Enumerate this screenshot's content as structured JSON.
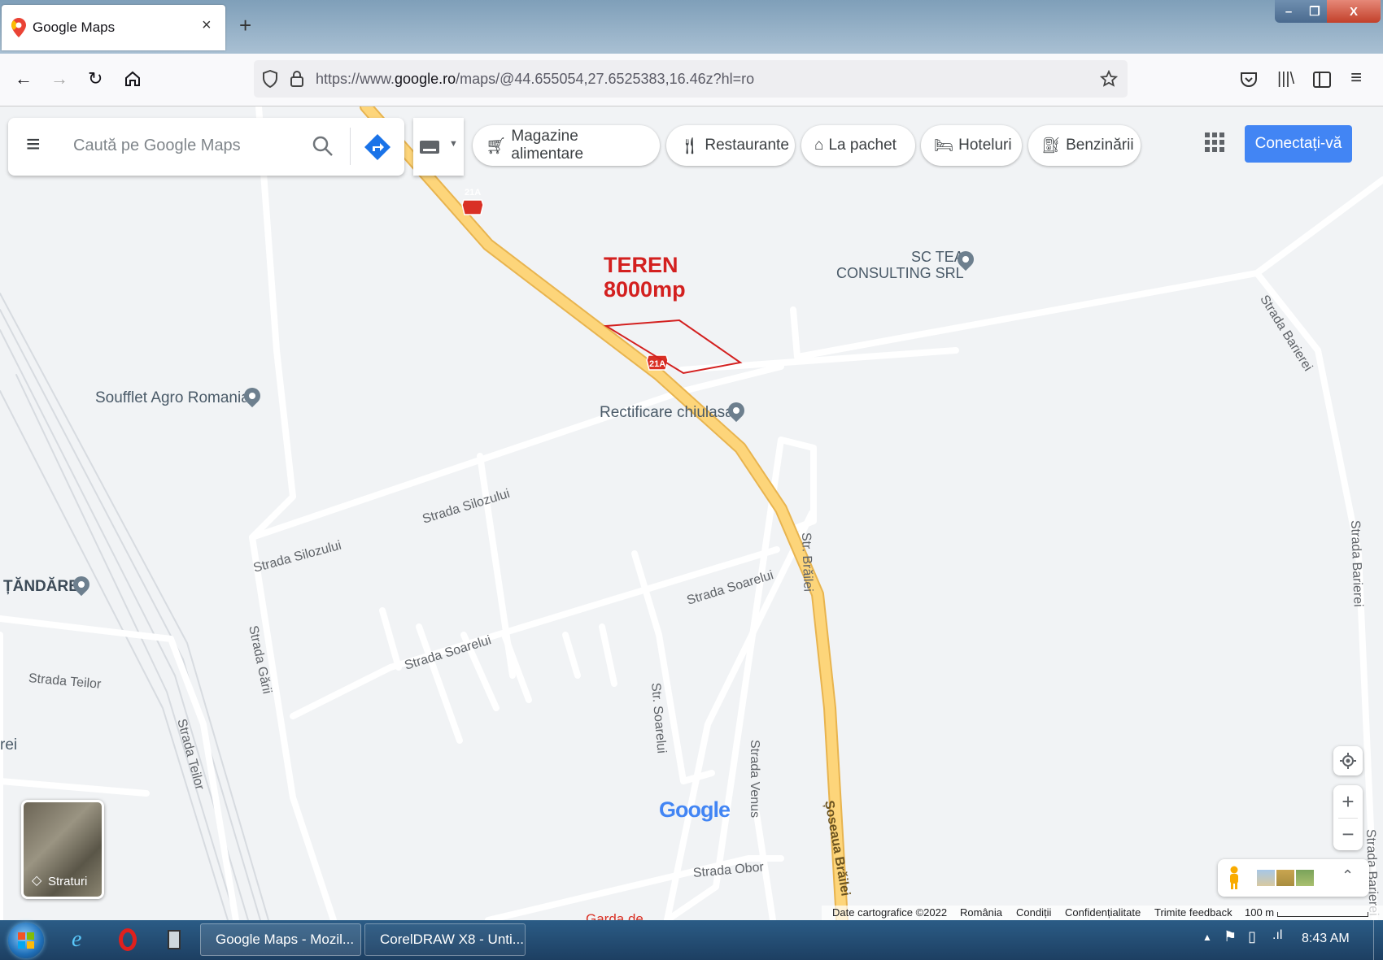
{
  "browser": {
    "tab_title": "Google Maps",
    "tab_close": "×",
    "new_tab": "+",
    "url_prefix": "https://www.",
    "url_domain": "google.ro",
    "url_path": "/maps/@44.655054,27.6525383,16.46z?hl=ro",
    "icons": [
      "back-icon",
      "forward-icon",
      "reload-icon",
      "home-icon",
      "shield-icon",
      "lock-icon",
      "star-icon",
      "pocket-icon",
      "library-icon",
      "sidebar-icon",
      "menu-icon"
    ]
  },
  "window_controls": {
    "minimize": "–",
    "restore": "❐",
    "close": "X"
  },
  "search": {
    "placeholder": "Caută pe Google Maps"
  },
  "chips": [
    {
      "label": "Magazine alimentare",
      "icon": "cart-icon"
    },
    {
      "label": "Restaurante",
      "icon": "fork-knife-icon"
    },
    {
      "label": "La pachet",
      "icon": "takeout-icon"
    },
    {
      "label": "Hoteluri",
      "icon": "bed-icon"
    },
    {
      "label": "Benzinării",
      "icon": "fuel-icon"
    }
  ],
  "signin_label": "Conectați-vă",
  "annotation": {
    "line1": "TEREN",
    "line2": "8000mp",
    "color": "#d3201f"
  },
  "map_labels": {
    "road_shield": "21A",
    "strada_silozului": "Strada Silozului",
    "strada_soarelui": "Strada Soarelui",
    "strada_garii": "Strada Gării",
    "strada_teilor": "Strada Teilor",
    "str_brailei": "Str. Brăilei",
    "str_soarelui": "Str. Soarelui",
    "strada_venus": "Strada Venus",
    "strada_obor": "Strada Obor",
    "soseaua_brailei": "Șoseaua Brăilei",
    "strada_barierei": "Strada Barierei",
    "strei": "rei"
  },
  "pois": {
    "sc_tea_1": "SC TEA",
    "sc_tea_2": "CONSULTING SRL",
    "soufflet": "Soufflet Agro Romania",
    "rectificare": "Rectificare chiulasa",
    "tandarei": "ȚĂNDĂREI",
    "garda": "Garda de"
  },
  "google_logo": "Google",
  "layers_label": "Straturi",
  "zoom": {
    "in": "+",
    "out": "−"
  },
  "footer": {
    "data": "Date cartografice ©2022",
    "country": "România",
    "terms": "Condiții",
    "privacy": "Confidențialitate",
    "feedback": "Trimite feedback",
    "scale": "100 m"
  },
  "taskbar": {
    "btn_firefox": "Google Maps - Mozil...",
    "btn_corel": "CorelDRAW X8 - Unti...",
    "clock": "8:43 AM"
  },
  "colors": {
    "highway": "#fdd57a",
    "highway_edge": "#e8b44f",
    "accent": "#4285f4",
    "road": "#ffffff"
  }
}
